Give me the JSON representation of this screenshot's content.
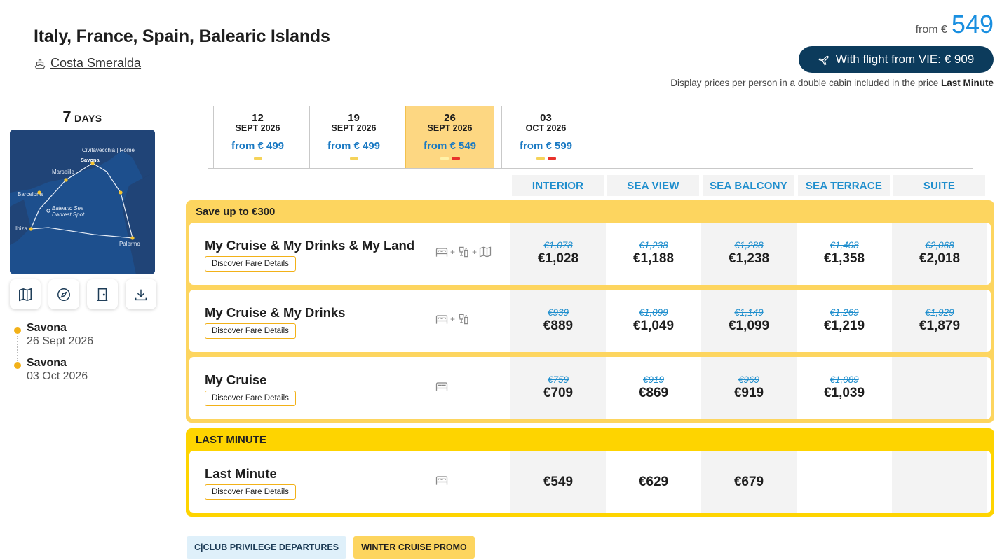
{
  "header": {
    "title": "Italy, France, Spain, Balearic Islands",
    "ship": "Costa Smeralda",
    "from_label": "from €",
    "from_value": "549",
    "flight_button": "With flight from VIE: € 909",
    "display_note": "Display prices per person in a double cabin included in the price",
    "display_note_bold": "Last Minute"
  },
  "duration": {
    "number": "7",
    "unit": "DAYS"
  },
  "map": {
    "ports": [
      "Civitavecchia | Rome",
      "Savona",
      "Marseille",
      "Barcelona",
      "Balearic Sea",
      "Darkest Spot",
      "Ibiza",
      "Palermo"
    ]
  },
  "map_tools": [
    "map-icon",
    "compass-icon",
    "door-icon",
    "download-icon"
  ],
  "itinerary": [
    {
      "port": "Savona",
      "date": "26 Sept 2026"
    },
    {
      "port": "Savona",
      "date": "03 Oct 2026"
    }
  ],
  "date_tabs": [
    {
      "day": "12",
      "month": "SEPT 2026",
      "price": "from € 499",
      "marks": [
        "#f5d35a"
      ],
      "selected": false
    },
    {
      "day": "19",
      "month": "SEPT 2026",
      "price": "from € 499",
      "marks": [
        "#f5d35a"
      ],
      "selected": false
    },
    {
      "day": "26",
      "month": "SEPT 2026",
      "price": "from € 549",
      "marks": [
        "#fff2a8",
        "#e8322b"
      ],
      "selected": true
    },
    {
      "day": "03",
      "month": "OCT 2026",
      "price": "from € 599",
      "marks": [
        "#f5d35a",
        "#e8322b"
      ],
      "selected": false
    }
  ],
  "cabins": [
    "INTERIOR",
    "SEA VIEW",
    "SEA BALCONY",
    "SEA TERRACE",
    "SUITE"
  ],
  "groups": [
    {
      "label": "Save up to €300",
      "fares": [
        {
          "name": "My Cruise & My Drinks & My Land",
          "button": "Discover Fare Details",
          "icons": [
            "bed-icon",
            "drinks-icon",
            "land-icon"
          ],
          "prices": [
            {
              "old": "€1,078",
              "new": "€1,028"
            },
            {
              "old": "€1,238",
              "new": "€1,188"
            },
            {
              "old": "€1,288",
              "new": "€1,238"
            },
            {
              "old": "€1,408",
              "new": "€1,358"
            },
            {
              "old": "€2,068",
              "new": "€2,018"
            }
          ]
        },
        {
          "name": "My Cruise & My Drinks",
          "button": "Discover Fare Details",
          "icons": [
            "bed-icon",
            "drinks-icon"
          ],
          "prices": [
            {
              "old": "€939",
              "new": "€889"
            },
            {
              "old": "€1,099",
              "new": "€1,049"
            },
            {
              "old": "€1,149",
              "new": "€1,099"
            },
            {
              "old": "€1,269",
              "new": "€1,219"
            },
            {
              "old": "€1,929",
              "new": "€1,879"
            }
          ]
        },
        {
          "name": "My Cruise",
          "button": "Discover Fare Details",
          "icons": [
            "bed-icon"
          ],
          "prices": [
            {
              "old": "€759",
              "new": "€709"
            },
            {
              "old": "€919",
              "new": "€869"
            },
            {
              "old": "€969",
              "new": "€919"
            },
            {
              "old": "€1,089",
              "new": "€1,039"
            },
            {
              "old": "",
              "new": ""
            }
          ]
        }
      ]
    },
    {
      "label": "LAST MINUTE",
      "fares": [
        {
          "name": "Last Minute",
          "button": "Discover Fare Details",
          "icons": [
            "bed-icon"
          ],
          "prices": [
            {
              "old": "",
              "new": "€549"
            },
            {
              "old": "",
              "new": "€629"
            },
            {
              "old": "",
              "new": "€679"
            },
            {
              "old": "",
              "new": ""
            },
            {
              "old": "",
              "new": ""
            }
          ]
        }
      ]
    }
  ],
  "badges": [
    "C|CLUB PRIVILEGE DEPARTURES",
    "WINTER CRUISE PROMO"
  ],
  "colors": {
    "accent_blue": "#1f8ecd",
    "flight_button": "#0c3b5c",
    "promo_yellow": "#fdd55f",
    "last_minute_yellow": "#fed400",
    "selected_tab": "#fdd782"
  }
}
